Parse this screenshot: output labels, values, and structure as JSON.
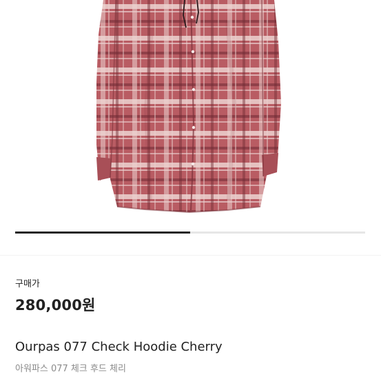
{
  "product": {
    "image_alt": "Ourpas 077 Check Hoodie Cherry",
    "pager_progress": 0.5,
    "price_label": "구매가",
    "price": "280,000원",
    "name": "Ourpas 077 Check Hoodie Cherry",
    "name_kr": "아워파스 077 체크 후드 체리"
  },
  "colors": {
    "shirt_base": "#b95c63",
    "stripe_light": "#ecd2d0",
    "stripe_dark": "#6e2a32",
    "pager_active": "#222222",
    "pager_track": "#e6e6e6"
  }
}
